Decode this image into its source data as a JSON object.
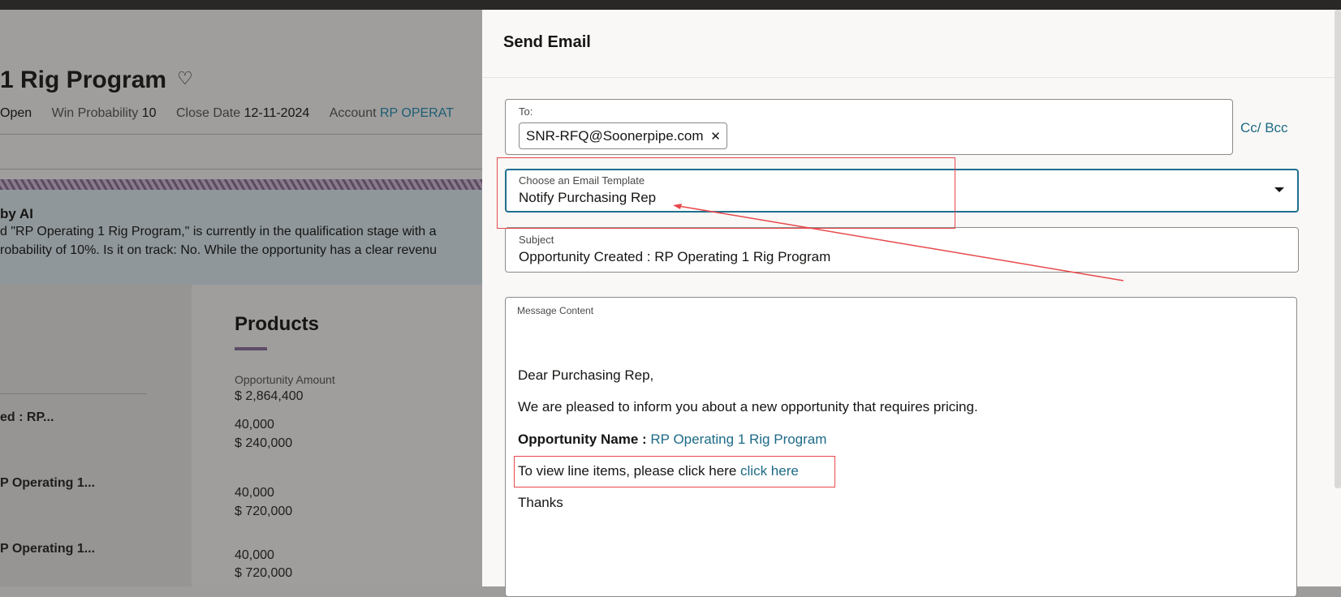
{
  "background": {
    "title": "1 Rig Program",
    "meta": {
      "status_value": "Open",
      "win_probability_label": "Win Probability",
      "win_probability_value": "10",
      "close_date_label": "Close Date",
      "close_date_value": "12-11-2024",
      "account_label": "Account",
      "account_value": "RP OPERAT"
    },
    "ai_summary": {
      "title": "by AI",
      "line1": "d \"RP Operating 1 Rig Program,\" is currently in the qualification stage with a",
      "line2": "robability of 10%. Is it on track: No. While the opportunity has a clear revenu"
    },
    "left_list": [
      "ed : RP...",
      "P Operating 1...",
      "P Operating 1..."
    ],
    "products": {
      "title": "Products",
      "amount_label": "Opportunity Amount",
      "amount_value": "$ 2,864,400",
      "items": [
        {
          "qty": "40,000",
          "amount": "$ 240,000"
        },
        {
          "qty": "40,000",
          "amount": "$ 720,000"
        },
        {
          "qty": "40,000",
          "amount": "$ 720,000"
        }
      ]
    }
  },
  "dialog": {
    "title": "Send Email",
    "to_label": "To:",
    "to_chip": "SNR-RFQ@Soonerpipe.com",
    "cc_bcc": "Cc/ Bcc",
    "template_label": "Choose an Email Template",
    "template_value": "Notify Purchasing Rep",
    "subject_label": "Subject",
    "subject_value": "Opportunity Created :  RP Operating 1 Rig Program",
    "message_label": "Message Content",
    "message": {
      "greeting": "Dear Purchasing Rep,",
      "intro": "We are pleased to inform you about a new opportunity that requires pricing.",
      "opp_name_label": "Opportunity Name :",
      "opp_name_value": "RP Operating 1 Rig Program",
      "view_text": "To view line items, please click here",
      "view_link": "click here",
      "closing": "Thanks"
    }
  },
  "annotation_color": "#e8484b",
  "accent_color": "#1d6a87"
}
